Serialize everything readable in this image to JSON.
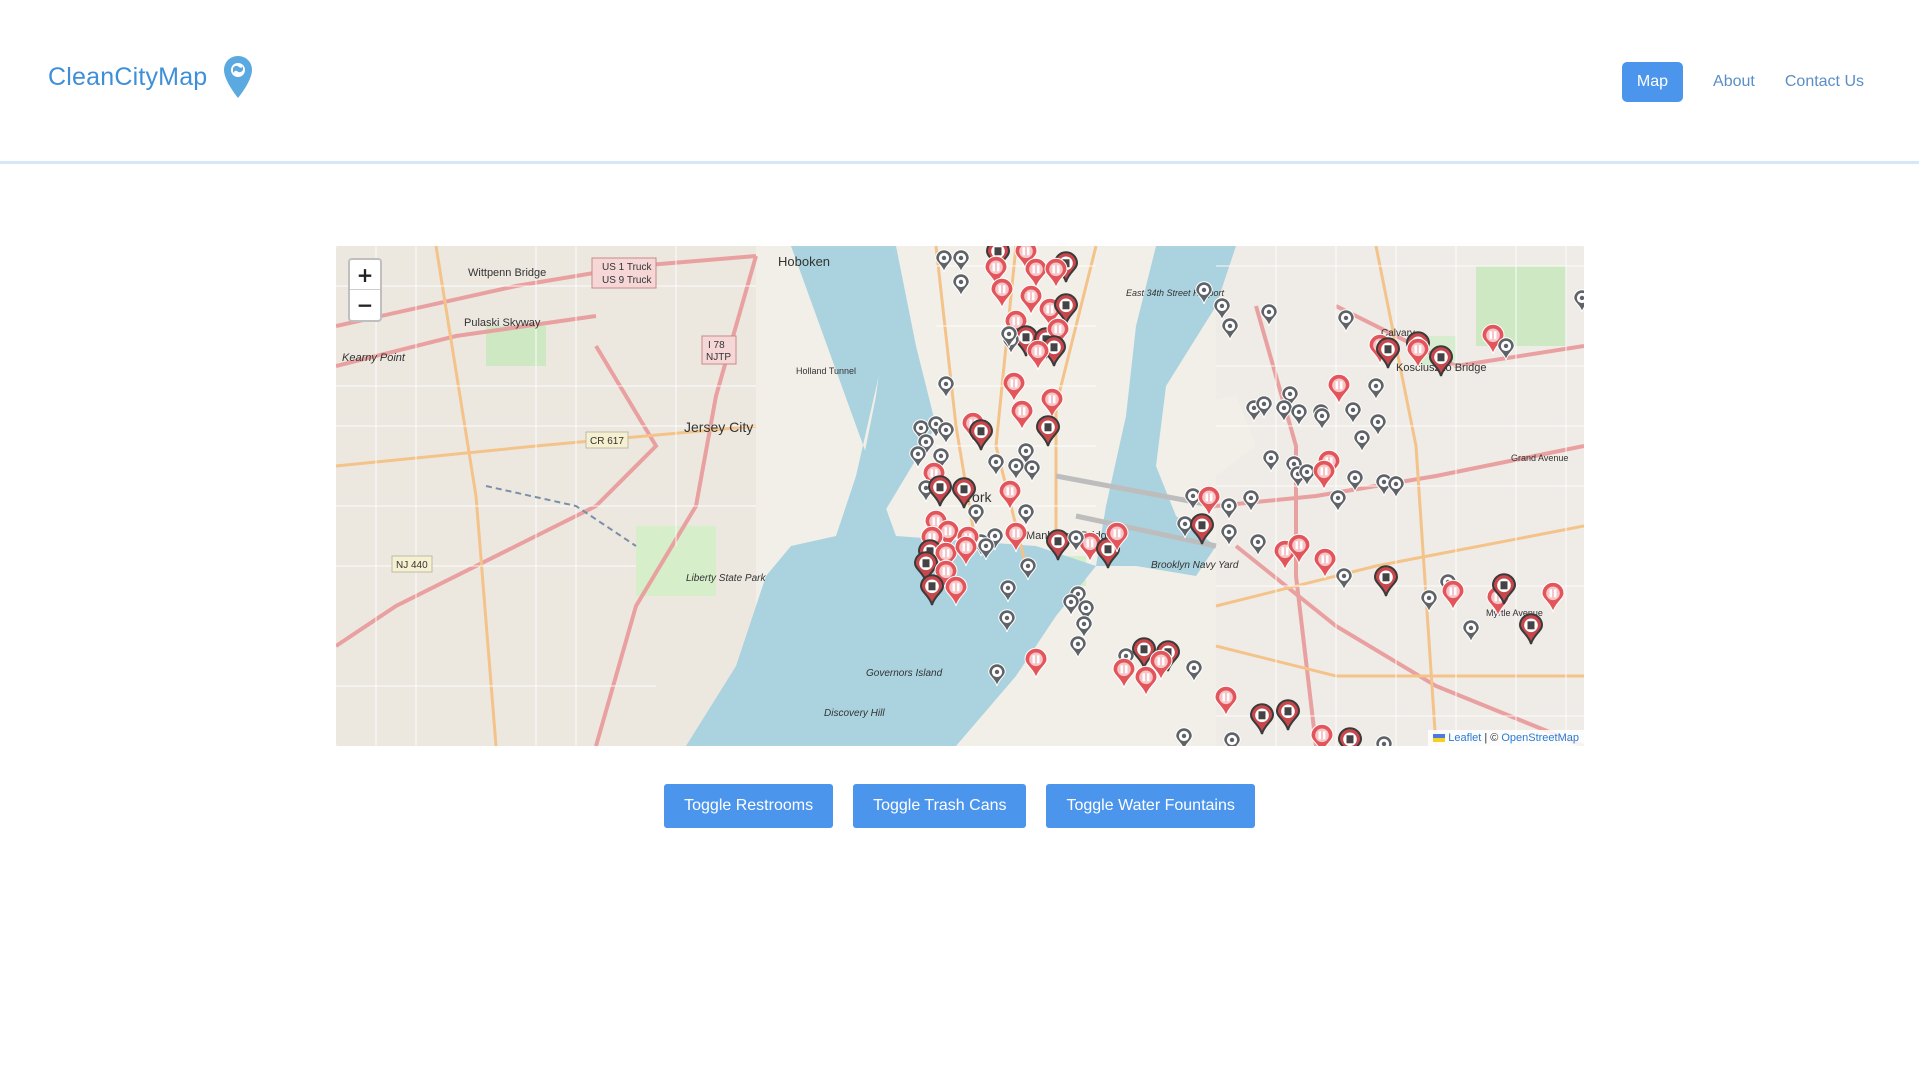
{
  "header": {
    "brand": "CleanCityMap",
    "brand_icon": "map-pin-icon",
    "nav": [
      {
        "label": "Map",
        "active": true
      },
      {
        "label": "About",
        "active": false
      },
      {
        "label": "Contact Us",
        "active": false
      }
    ]
  },
  "map": {
    "zoom_in": "+",
    "zoom_out": "−",
    "attribution": {
      "leaflet": "Leaflet",
      "separator": "| ©",
      "osm": "OpenStreetMap"
    },
    "labels": {
      "hoboken": "Hoboken",
      "jersey_city": "Jersey City",
      "new_york": "York",
      "manhattan_bridge": "Manhattan Bridge",
      "pulaski": "Pulaski Skyway",
      "wittpenn": "Wittpenn Bridge",
      "kearny": "Kearny Point",
      "brooklyn_navy": "Brooklyn Navy Yard",
      "governors": "Governors Island",
      "liberty_park": "Liberty State Park",
      "kosciuszko": "Kosciuszko Bridge",
      "calvary": "Calvary",
      "us1": "US 1 Truck",
      "us9": "US 9 Truck",
      "i78": "I 78",
      "njtp": "NJTP",
      "cr617": "CR 617",
      "nj440": "NJ 440",
      "holland": "Holland Tunnel",
      "east34": "East 34th Street Heliport",
      "discovery": "Discovery Hill",
      "myrtle": "Myrtle Avenue",
      "grand": "Grand Avenue"
    },
    "colors": {
      "restroom": "#e2555b",
      "trash": "#c8474c",
      "fountain": "#5f6368",
      "water": "#aad3df"
    }
  },
  "controls": {
    "restrooms": "Toggle Restrooms",
    "trash": "Toggle Trash Cans",
    "fountains": "Toggle Water Fountains"
  }
}
